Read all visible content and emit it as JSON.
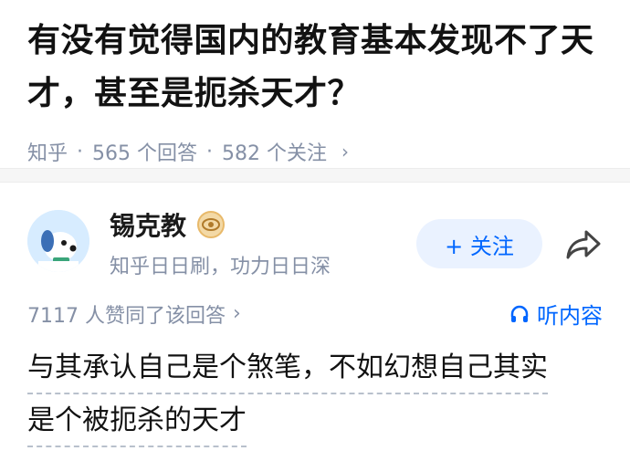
{
  "question": {
    "title": "有没有觉得国内的教育基本发现不了天才，甚至是扼杀天才？",
    "source": "知乎",
    "separator": "·",
    "answers_count": "565 个回答",
    "followers_count": "582 个关注",
    "chevron": "›"
  },
  "author": {
    "name": "锡克教",
    "description": "知乎日日刷，功力日日深",
    "follow_label": "+ 关注"
  },
  "votes": {
    "text": "7117 人赞同了该回答",
    "chevron": "›"
  },
  "listen": {
    "label": "听内容"
  },
  "answer": {
    "line1": "与其承认自己是个煞笔，不如幻想自己其实",
    "line2": "是个被扼杀的天才"
  },
  "colors": {
    "accent": "#0066ff",
    "meta": "#8590a6",
    "follow_bg": "#eaf2ff"
  },
  "icons": [
    "avatar-dog-icon",
    "badge-eye-icon",
    "share-icon",
    "headphones-icon"
  ]
}
